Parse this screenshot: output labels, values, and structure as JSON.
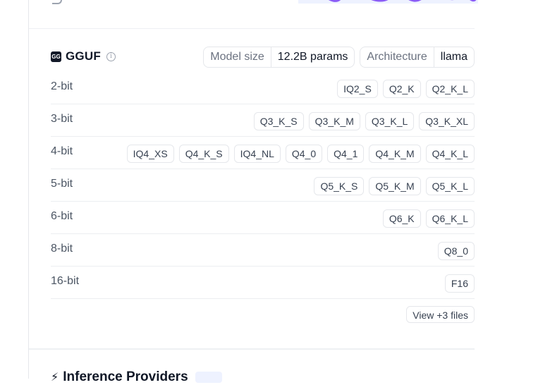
{
  "gguf": {
    "name": "GGUF",
    "logo_text": "GG",
    "info_icon": "info-icon",
    "model_size_label": "Model size",
    "model_size_value": "12.2B params",
    "architecture_label": "Architecture",
    "architecture_value": "llama"
  },
  "quant_rows": [
    {
      "label": "2-bit",
      "chips": [
        "IQ2_S",
        "Q2_K",
        "Q2_K_L"
      ]
    },
    {
      "label": "3-bit",
      "chips": [
        "Q3_K_S",
        "Q3_K_M",
        "Q3_K_L",
        "Q3_K_XL"
      ]
    },
    {
      "label": "4-bit",
      "chips": [
        "IQ4_XS",
        "Q4_K_S",
        "IQ4_NL",
        "Q4_0",
        "Q4_1",
        "Q4_K_M",
        "Q4_K_L"
      ]
    },
    {
      "label": "5-bit",
      "chips": [
        "Q5_K_S",
        "Q5_K_M",
        "Q5_K_L"
      ]
    },
    {
      "label": "6-bit",
      "chips": [
        "Q6_K",
        "Q6_K_L"
      ]
    },
    {
      "label": "8-bit",
      "chips": [
        "Q8_0"
      ]
    },
    {
      "label": "16-bit",
      "chips": [
        "F16"
      ]
    }
  ],
  "view_more_label": "View +3 files",
  "inference": {
    "title": "Inference Providers",
    "icon": "lightning-icon"
  },
  "colors": {
    "accent_purple": "#8b5cf6",
    "chip_border": "#e5e7eb"
  }
}
